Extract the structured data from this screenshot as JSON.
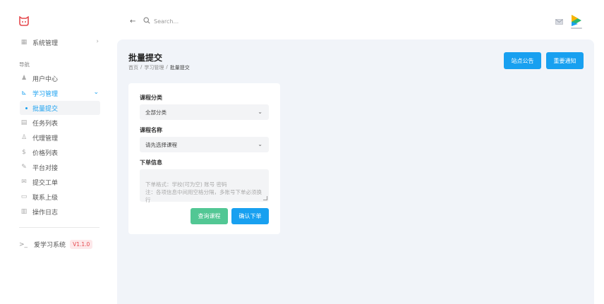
{
  "colors": {
    "accent": "#18a0f0",
    "success": "#52c794",
    "badge_bg": "#fde8ea",
    "badge_text": "#e5484d"
  },
  "sidebar": {
    "logo_icon": "cat-logo-icon",
    "system_manage": "系统管理",
    "section_label": "导航",
    "items": [
      {
        "label": "用户中心",
        "icon": "user-icon"
      },
      {
        "label": "学习管理",
        "icon": "cart-icon"
      },
      {
        "label": "任务列表",
        "icon": "task-icon"
      },
      {
        "label": "代理管理",
        "icon": "agent-icon"
      },
      {
        "label": "价格列表",
        "icon": "dollar-icon"
      },
      {
        "label": "平台对接",
        "icon": "link-icon"
      },
      {
        "label": "提交工单",
        "icon": "mail-icon"
      },
      {
        "label": "联系上级",
        "icon": "contact-icon"
      },
      {
        "label": "操作日志",
        "icon": "log-icon"
      }
    ],
    "sub_item": "批量提交",
    "version_name": "爱学习系统",
    "version_badge": "V1.1.0"
  },
  "topbar": {
    "search_placeholder": "Search..."
  },
  "main": {
    "title": "批量提交",
    "breadcrumb": [
      "首页",
      "/",
      "学习管理",
      "/",
      "批量提交"
    ],
    "btn_notice": "站点公告",
    "btn_important": "重要通知",
    "form": {
      "category_label": "课程分类",
      "category_value": "全部分类",
      "course_label": "课程名称",
      "course_value": "请先选择课程",
      "order_label": "下单信息",
      "order_placeholder": "下单格式：学校(可为空) 账号 密码\n注：各项信息中间用空格分隔，多账号下单必须换行",
      "btn_query": "查询课程",
      "btn_confirm": "确认下单"
    }
  }
}
